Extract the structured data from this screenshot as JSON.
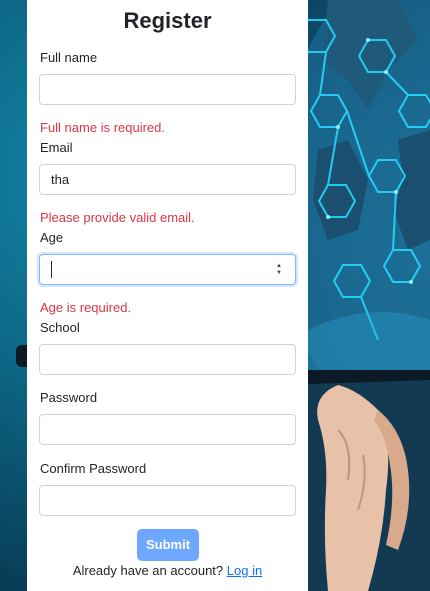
{
  "form": {
    "title": "Register",
    "full_name": {
      "label": "Full name",
      "value": "",
      "error": "Full name is required."
    },
    "email": {
      "label": "Email",
      "value": "tha",
      "error": "Please provide valid email."
    },
    "age": {
      "label": "Age",
      "value": "",
      "error": "Age is required."
    },
    "school": {
      "label": "School",
      "value": ""
    },
    "password": {
      "label": "Password",
      "value": ""
    },
    "confirm_password": {
      "label": "Confirm Password",
      "value": ""
    },
    "submit_label": "Submit",
    "footer_text": "Already have an account?",
    "login_link": "Log in"
  },
  "colors": {
    "error": "#dc3545",
    "link": "#0d6efd",
    "submit_bg": "#6ea8fe"
  }
}
